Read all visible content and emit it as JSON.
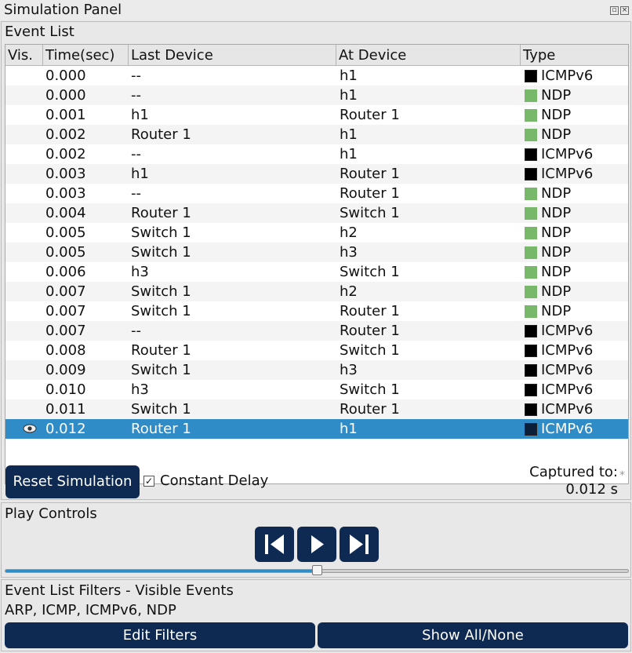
{
  "window": {
    "title": "Simulation Panel",
    "float_glyph": "▫",
    "close_glyph": "×"
  },
  "event_list": {
    "label": "Event List",
    "columns": [
      "Vis.",
      "Time(sec)",
      "Last Device",
      "At Device",
      "Type"
    ],
    "rows": [
      {
        "time": "0.000",
        "last": "--",
        "at": "h1",
        "type": "ICMPv6",
        "color": "#000000"
      },
      {
        "time": "0.000",
        "last": "--",
        "at": "h1",
        "type": "NDP",
        "color": "#78b86a"
      },
      {
        "time": "0.001",
        "last": "h1",
        "at": "Router 1",
        "type": "NDP",
        "color": "#78b86a"
      },
      {
        "time": "0.002",
        "last": "Router 1",
        "at": "h1",
        "type": "NDP",
        "color": "#78b86a"
      },
      {
        "time": "0.002",
        "last": "--",
        "at": "h1",
        "type": "ICMPv6",
        "color": "#000000"
      },
      {
        "time": "0.003",
        "last": "h1",
        "at": "Router 1",
        "type": "ICMPv6",
        "color": "#000000"
      },
      {
        "time": "0.003",
        "last": "--",
        "at": "Router 1",
        "type": "NDP",
        "color": "#78b86a"
      },
      {
        "time": "0.004",
        "last": "Router 1",
        "at": "Switch 1",
        "type": "NDP",
        "color": "#78b86a"
      },
      {
        "time": "0.005",
        "last": "Switch 1",
        "at": "h2",
        "type": "NDP",
        "color": "#78b86a"
      },
      {
        "time": "0.005",
        "last": "Switch 1",
        "at": "h3",
        "type": "NDP",
        "color": "#78b86a"
      },
      {
        "time": "0.006",
        "last": "h3",
        "at": "Switch 1",
        "type": "NDP",
        "color": "#78b86a"
      },
      {
        "time": "0.007",
        "last": "Switch 1",
        "at": "h2",
        "type": "NDP",
        "color": "#78b86a"
      },
      {
        "time": "0.007",
        "last": "Switch 1",
        "at": "Router 1",
        "type": "NDP",
        "color": "#78b86a"
      },
      {
        "time": "0.007",
        "last": "--",
        "at": "Router 1",
        "type": "ICMPv6",
        "color": "#000000"
      },
      {
        "time": "0.008",
        "last": "Router 1",
        "at": "Switch 1",
        "type": "ICMPv6",
        "color": "#000000"
      },
      {
        "time": "0.009",
        "last": "Switch 1",
        "at": "h3",
        "type": "ICMPv6",
        "color": "#000000"
      },
      {
        "time": "0.010",
        "last": "h3",
        "at": "Switch 1",
        "type": "ICMPv6",
        "color": "#000000"
      },
      {
        "time": "0.011",
        "last": "Switch 1",
        "at": "Router 1",
        "type": "ICMPv6",
        "color": "#000000"
      },
      {
        "time": "0.012",
        "last": "Router 1",
        "at": "h1",
        "type": "ICMPv6",
        "color": "#000000",
        "selected": true,
        "visible_eye": true
      }
    ],
    "selected_color": "#308cc6",
    "reset_button": "Reset Simulation",
    "constant_delay_label": "Constant Delay",
    "constant_delay_checked": true,
    "check_glyph": "✓",
    "captured_label": "Captured to:",
    "captured_value": "0.012 s",
    "asterisk": "*"
  },
  "play_controls": {
    "label": "Play Controls",
    "buttons": [
      {
        "name": "back",
        "icon": "skip-back-icon"
      },
      {
        "name": "play",
        "icon": "play-icon"
      },
      {
        "name": "forward",
        "icon": "skip-forward-icon"
      }
    ],
    "progress_fraction": 0.5
  },
  "filters": {
    "label": "Event List Filters - Visible Events",
    "visible": "ARP, ICMP, ICMPv6, NDP",
    "edit_button": "Edit Filters",
    "show_button": "Show All/None"
  },
  "colors": {
    "accent_dark": "#0e2a52",
    "ndp": "#78b86a",
    "icmpv6": "#000000"
  }
}
